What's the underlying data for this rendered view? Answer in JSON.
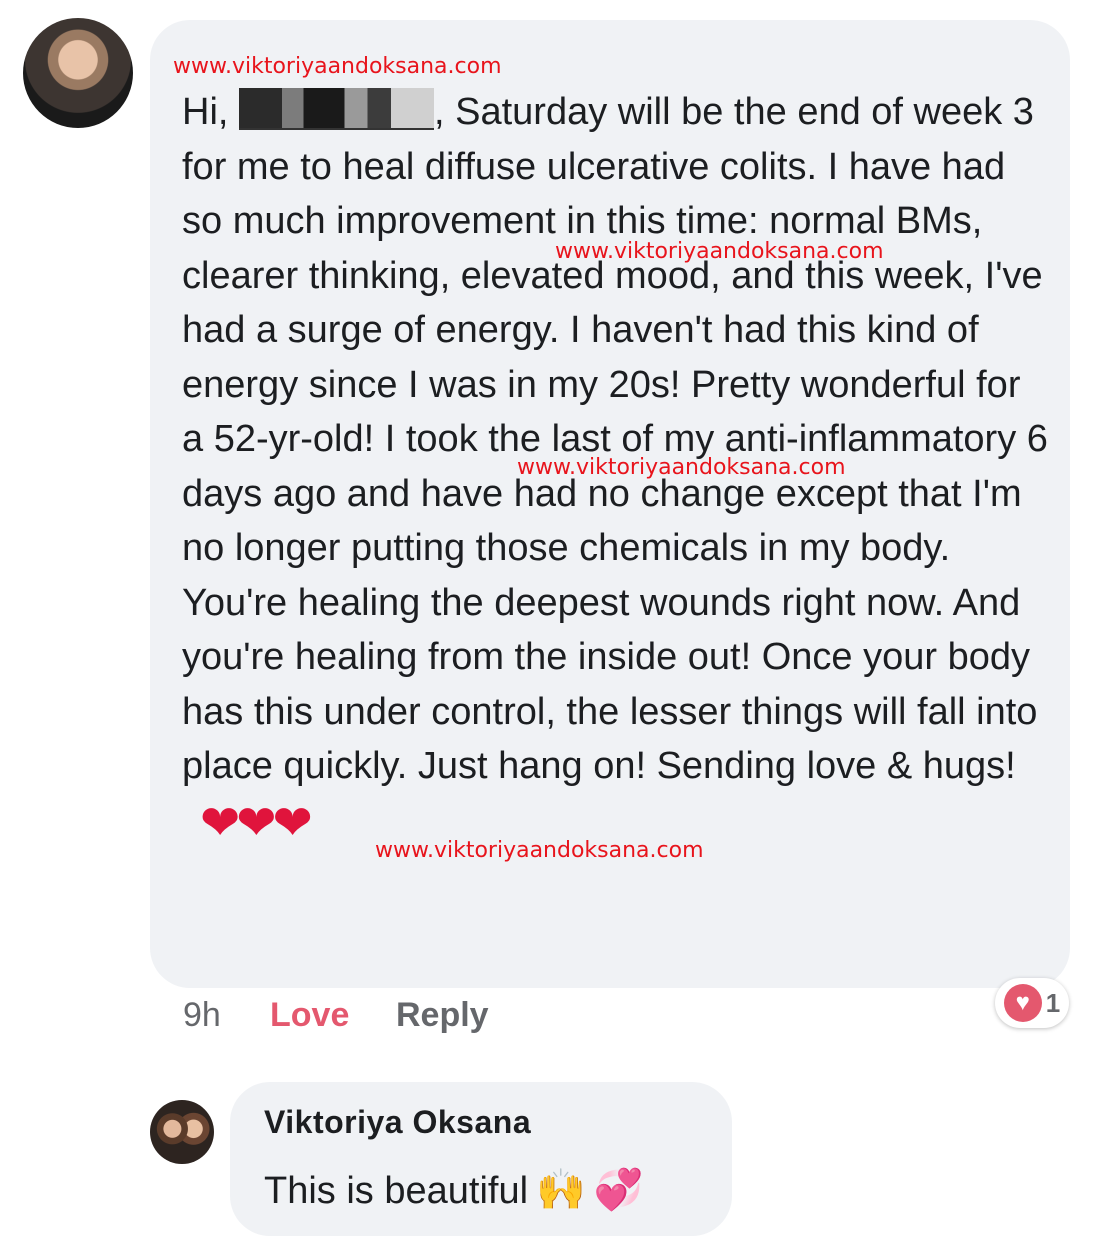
{
  "comment": {
    "greeting": "Hi,",
    "text": ", Saturday will be the end of week 3 for me to heal diffuse ulcerative colits. I have had so much improvement in this time: normal BMs, clearer thinking, elevated mood, and this week, I've had a surge of energy. I haven't had this kind of energy since I was in my 20s! Pretty wonderful for a 52-yr-old!  I took the last of my anti-inflammatory 6 days ago and have had no change except that I'm no longer putting those chemicals in my body. You're healing the deepest wounds right now. And you're healing from the inside out! Once your body has this under control, the lesser things will fall into place quickly. Just hang on! Sending love & hugs!",
    "hearts": "❤❤❤",
    "time": "9h",
    "love_label": "Love",
    "reply_label": "Reply",
    "reaction_icon": "♥",
    "reaction_count": "1"
  },
  "watermarks": [
    "www.viktoriyaandoksana.com",
    "www.viktoriyaandoksana.com",
    "www.viktoriyaandoksana.com",
    "www.viktoriyaandoksana.com"
  ],
  "reply": {
    "author": "Viktoriya Oksana",
    "text": "This is beautiful",
    "emoji_hands": "🙌",
    "emoji_hearts": "💞"
  },
  "colors": {
    "bubble": "#f0f2f5",
    "love": "#e4586e",
    "watermark": "#e8141c",
    "meta": "#65676b"
  }
}
